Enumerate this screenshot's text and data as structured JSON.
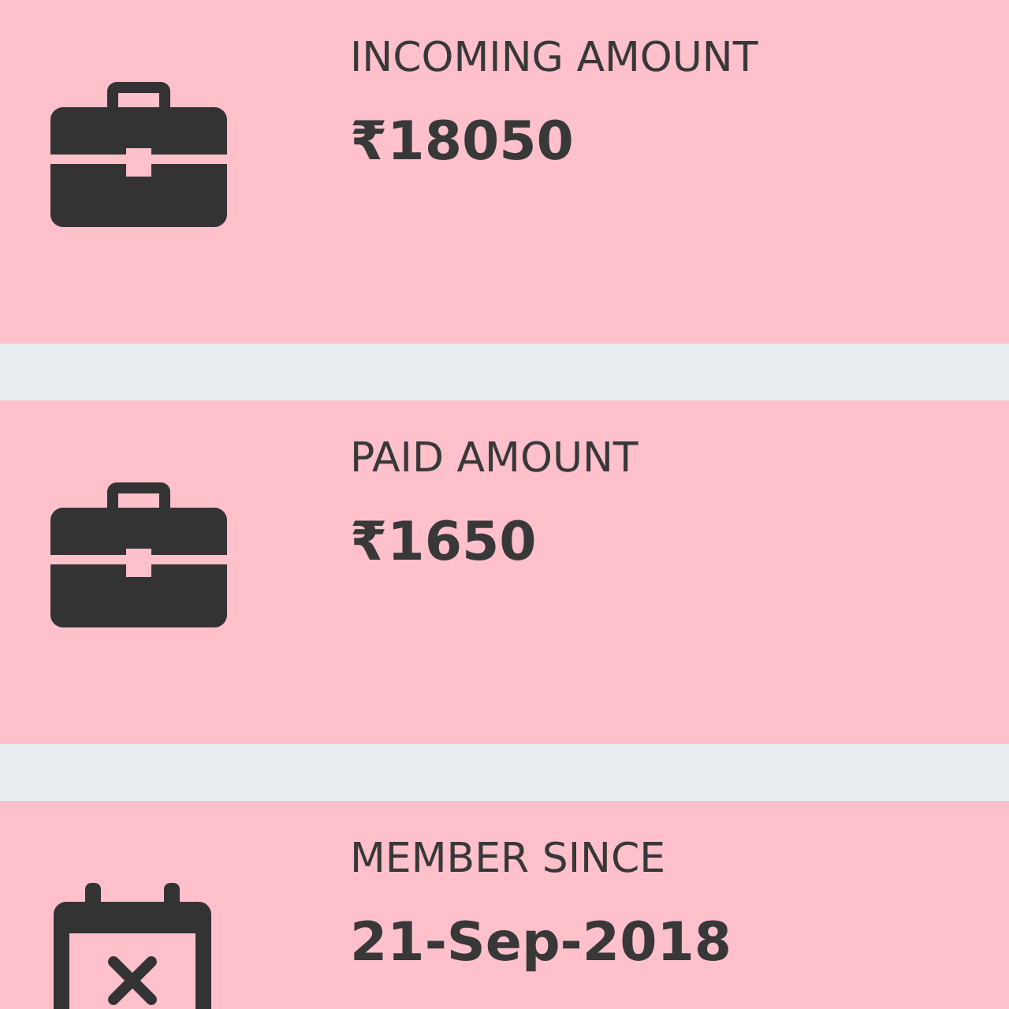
{
  "cards": [
    {
      "kind": "briefcase",
      "label": "INCOMING AMOUNT",
      "value": "₹18050"
    },
    {
      "kind": "briefcase",
      "label": "PAID AMOUNT",
      "value": "₹1650"
    },
    {
      "kind": "calendar",
      "label": "MEMBER SINCE",
      "value": "21-Sep-2018"
    }
  ]
}
